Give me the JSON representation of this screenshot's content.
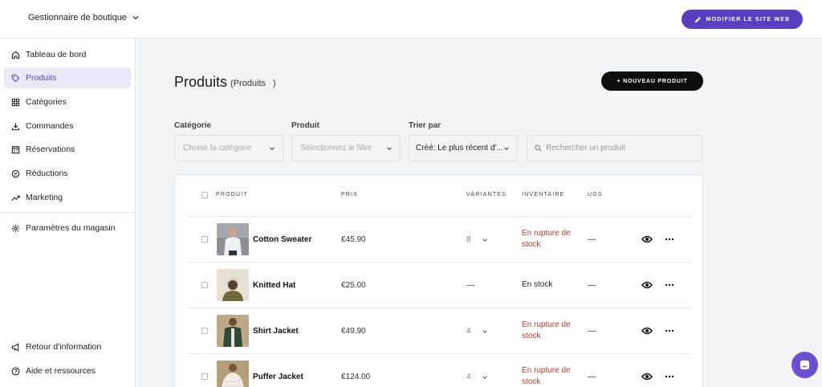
{
  "header": {
    "store_label": "Gestionnaire de boutique",
    "edit_site_label": "MODIFIER LE SITE WEB"
  },
  "sidebar": {
    "items": [
      {
        "label": "Tableau de bord",
        "icon": "home-icon"
      },
      {
        "label": "Produits",
        "icon": "tag-icon",
        "active": true
      },
      {
        "label": "Catégories",
        "icon": "grid-icon"
      },
      {
        "label": "Commandes",
        "icon": "download-icon"
      },
      {
        "label": "Réservations",
        "icon": "calendar-icon"
      },
      {
        "label": "Réductions",
        "icon": "discount-icon"
      },
      {
        "label": "Marketing",
        "icon": "trend-icon"
      },
      {
        "label": "Paramètres du magasin",
        "icon": "gear-icon"
      },
      {
        "label": "Retour d'information",
        "icon": "megaphone-icon"
      },
      {
        "label": "Aide et ressources",
        "icon": "help-icon"
      }
    ]
  },
  "main": {
    "title": "Produits",
    "subtitle": "(Produits",
    "subtitle_close": ")",
    "new_product_label": "+ NOUVEAU PRODUIT",
    "filters": {
      "category_label": "Catégorie",
      "category_placeholder": "Choisir la catégorie",
      "product_label": "Produit",
      "product_placeholder": "Sélectionnez le filtre",
      "sort_label": "Trier par",
      "sort_value": "Créé:  Le plus récent d'...",
      "search_placeholder": "Rechercher un produit"
    },
    "table": {
      "headers": [
        "PRODUIT",
        "PRIX",
        "VARIANTES",
        "INVENTAIRE",
        "UGS"
      ],
      "rows": [
        {
          "name": "Cotton Sweater",
          "price": "€45.90",
          "variants": "8",
          "stock": "En rupture de stock",
          "stock_status": "out",
          "sku": "—"
        },
        {
          "name": "Knitted Hat",
          "price": "€25.00",
          "variants": "—",
          "stock": "En stock",
          "stock_status": "in",
          "sku": "—"
        },
        {
          "name": "Shirt Jacket",
          "price": "€49.90",
          "variants": "4",
          "stock": "En rupture de stock",
          "stock_status": "out",
          "sku": "—"
        },
        {
          "name": "Puffer Jacket",
          "price": "€124.00",
          "variants": "4",
          "stock": "En rupture de stock",
          "stock_status": "out",
          "sku": "—"
        }
      ]
    }
  },
  "colors": {
    "accent": "#5a3fc0",
    "out_of_stock": "#c0392b",
    "chat_button": "#6a4fd0"
  }
}
